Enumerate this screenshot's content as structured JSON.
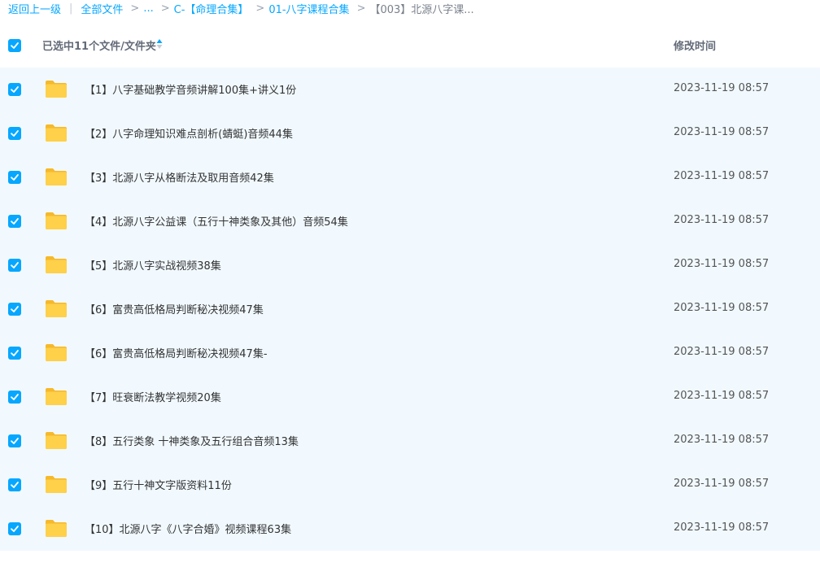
{
  "breadcrumb": {
    "back": "返回上一级",
    "all_files": "全部文件",
    "ellipsis": "...",
    "level1": "C-【命理合集】",
    "level2": "01-八字课程合集",
    "current": "【003】北源八字课..."
  },
  "header": {
    "selected_label": "已选中11个文件/文件夹",
    "time_label": "修改时间"
  },
  "colors": {
    "accent": "#06a7ff",
    "row_selected_bg": "#f1f9ff",
    "folder": "#ffd04a"
  },
  "files": [
    {
      "name": "【1】八字基础教学音频讲解100集+讲义1份",
      "time": "2023-11-19 08:57"
    },
    {
      "name": "【2】八字命理知识难点剖析(蜻蜓)音频44集",
      "time": "2023-11-19 08:57"
    },
    {
      "name": "【3】北源八字从格断法及取用音频42集",
      "time": "2023-11-19 08:57"
    },
    {
      "name": "【4】北源八字公益课（五行十神类象及其他）音频54集",
      "time": "2023-11-19 08:57"
    },
    {
      "name": "【5】北源八字实战视频38集",
      "time": "2023-11-19 08:57"
    },
    {
      "name": "【6】富贵高低格局判断秘决视频47集",
      "time": "2023-11-19 08:57"
    },
    {
      "name": "【6】富贵高低格局判断秘决视频47集-",
      "time": "2023-11-19 08:57"
    },
    {
      "name": "【7】旺衰断法教学视频20集",
      "time": "2023-11-19 08:57"
    },
    {
      "name": "【8】五行类象 十神类象及五行组合音频13集",
      "time": "2023-11-19 08:57"
    },
    {
      "name": "【9】五行十神文字版资料11份",
      "time": "2023-11-19 08:57"
    },
    {
      "name": "【10】北源八字《八字合婚》视频课程63集",
      "time": "2023-11-19 08:57"
    }
  ]
}
